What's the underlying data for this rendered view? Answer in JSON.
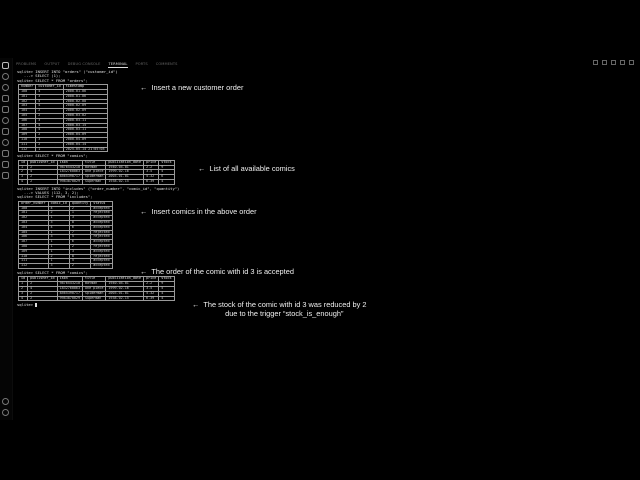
{
  "panel_tabs": [
    "PROBLEMS",
    "OUTPUT",
    "DEBUG CONSOLE",
    "TERMINAL",
    "PORTS",
    "COMMENTS"
  ],
  "ports_badge": "",
  "terminal": {
    "cmd1": "sqlite> INSERT INTO \"orders\" (\"customer_id\")",
    "cmd1b": "   ...> SELECT (1);",
    "cmd2": "sqlite> SELECT * FROM \"orders\";",
    "orders": {
      "headers": [
        "number",
        "customer_id",
        "timestamp"
      ],
      "rows": [
        [
          "100",
          "4",
          "2000-01-06"
        ],
        [
          "101",
          "3",
          "2000-01-06"
        ],
        [
          "102",
          "5",
          "2000-02-08"
        ],
        [
          "103",
          "4",
          "2000-02-09"
        ],
        [
          "104",
          "2",
          "2000-02-09"
        ],
        [
          "105",
          "2",
          "2000-03-02"
        ],
        [
          "106",
          "3",
          "2000-03-11"
        ],
        [
          "107",
          "4",
          "2000-03-15"
        ],
        [
          "108",
          "4",
          "2000-03-11"
        ],
        [
          "109",
          "2",
          "2000-04-09"
        ],
        [
          "110",
          "3",
          "2000-04-09"
        ],
        [
          "111",
          "2",
          "2000-04-14"
        ],
        [
          "112",
          "1",
          "2025-05-14 21:05:08"
        ]
      ]
    },
    "cmd3": "sqlite> SELECT * FROM \"comics\";",
    "comics1": {
      "headers": [
        "id",
        "publisher_id",
        "isbn",
        "title",
        "publication_date",
        "price",
        "stock"
      ],
      "rows": [
        [
          "1",
          "2",
          "9876543210",
          "Batman",
          "1940-04-01",
          "2.2",
          "9"
        ],
        [
          "2",
          "4",
          "1832760063",
          "One piece",
          "1999-02-16",
          "3.5",
          "5"
        ],
        [
          "3",
          "2",
          "8565390717",
          "Spiderman",
          "2003-01-01",
          "5.32",
          "6"
        ],
        [
          "4",
          "2",
          "9983870029",
          "Superman",
          "1938-02-15",
          "6.39",
          "4"
        ]
      ]
    },
    "cmd4": "sqlite> INSERT INTO \"includes\" (\"order_number\", \"comic_id\", \"quantity\")",
    "cmd4b": "   ...> VALUES (112, 3, 2);",
    "cmd5": "sqlite> SELECT * FROM \"includes\";",
    "includes": {
      "headers": [
        "order_number",
        "comic_id",
        "quantity",
        "status"
      ],
      "rows": [
        [
          "100",
          "4",
          "2",
          "accepted"
        ],
        [
          "101",
          "2",
          "1",
          "rejected"
        ],
        [
          "102",
          "1",
          "3",
          "accepted"
        ],
        [
          "103",
          "3",
          "8",
          "accepted"
        ],
        [
          "104",
          "4",
          "6",
          "accepted"
        ],
        [
          "105",
          "1",
          "7",
          "rejected"
        ],
        [
          "106",
          "3",
          "5",
          "rejected"
        ],
        [
          "107",
          "1",
          "6",
          "accepted"
        ],
        [
          "108",
          "1",
          "2",
          "rejected"
        ],
        [
          "109",
          "1",
          "3",
          "accepted"
        ],
        [
          "110",
          "2",
          "8",
          "rejected"
        ],
        [
          "111",
          "1",
          "5",
          "accepted"
        ],
        [
          "112",
          "3",
          "2",
          "accepted"
        ]
      ]
    },
    "cmd6": "sqlite> SELECT * FROM \"comics\";",
    "comics2": {
      "headers": [
        "id",
        "publisher_id",
        "isbn",
        "title",
        "publication_date",
        "price",
        "stock"
      ],
      "rows": [
        [
          "1",
          "2",
          "9876543210",
          "Batman",
          "1940-04-01",
          "2.2",
          "9"
        ],
        [
          "2",
          "4",
          "1832760063",
          "One piece",
          "1999-02-16",
          "3.5",
          "5"
        ],
        [
          "3",
          "2",
          "8565390717",
          "Spiderman",
          "2003-01-01",
          "5.32",
          "4"
        ],
        [
          "4",
          "2",
          "9983870029",
          "Superman",
          "1938-02-15",
          "6.39",
          "4"
        ]
      ]
    },
    "final_prompt": "sqlite> "
  },
  "annotations": {
    "a1": "Insert a new customer order",
    "a2": "List of all available comics",
    "a3": "Insert comics in the above order",
    "a4": "The order of the comic with id 3 is accepted",
    "a5_line1": "The stock of the comic with id 3 was reduced by 2",
    "a5_line2": "due to the trigger “stock_is_enough”",
    "arrow": "←"
  },
  "icons": [
    "files-icon",
    "search-icon",
    "source-control-icon",
    "run-debug-icon",
    "extensions-icon",
    "remote-icon",
    "testing-icon",
    "database-icon",
    "docker-icon",
    "account-icon",
    "settings-icon"
  ]
}
